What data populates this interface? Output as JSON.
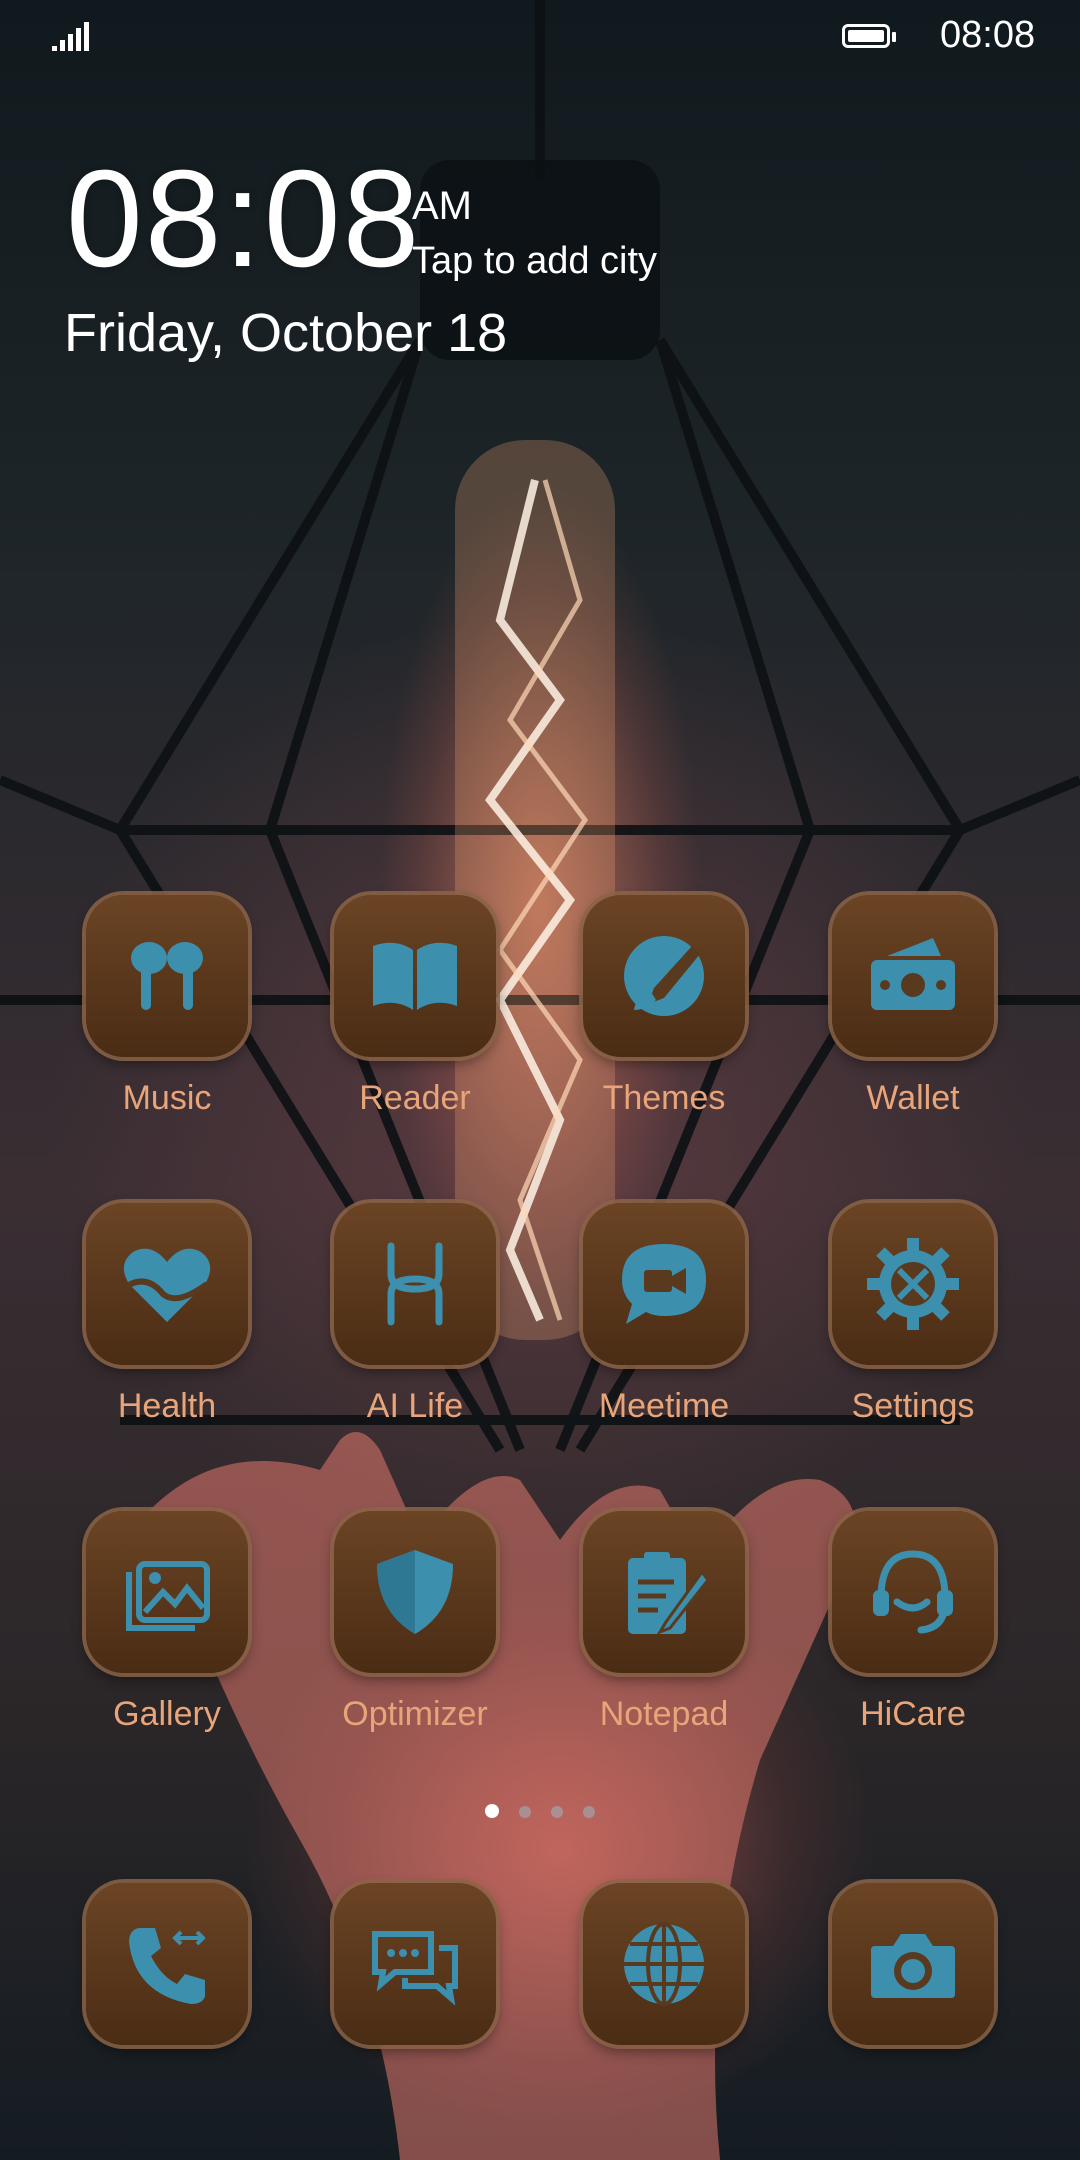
{
  "status_bar": {
    "time": "08:08",
    "signal_icon": "signal-icon",
    "battery_icon": "battery-icon"
  },
  "clock_widget": {
    "time": "08:08",
    "ampm": "AM",
    "city_prompt": "Tap to add city",
    "date": "Friday, October 18"
  },
  "apps": [
    {
      "label": "Music",
      "icon": "earbuds-icon"
    },
    {
      "label": "Reader",
      "icon": "book-icon"
    },
    {
      "label": "Themes",
      "icon": "paintbrush-icon"
    },
    {
      "label": "Wallet",
      "icon": "wallet-icon"
    },
    {
      "label": "Health",
      "icon": "heart-icon"
    },
    {
      "label": "AI Life",
      "icon": "ai-life-icon"
    },
    {
      "label": "Meetime",
      "icon": "video-chat-icon"
    },
    {
      "label": "Settings",
      "icon": "gear-icon"
    },
    {
      "label": "Gallery",
      "icon": "gallery-icon"
    },
    {
      "label": "Optimizer",
      "icon": "shield-icon"
    },
    {
      "label": "Notepad",
      "icon": "notepad-icon"
    },
    {
      "label": "HiCare",
      "icon": "headset-icon"
    }
  ],
  "dock": [
    {
      "icon": "phone-icon"
    },
    {
      "icon": "messages-icon"
    },
    {
      "icon": "browser-globe-icon"
    },
    {
      "icon": "camera-icon"
    }
  ],
  "page_indicator": {
    "pages": 4,
    "active": 1
  },
  "colors": {
    "icon_glyph": "#3d8fae",
    "tile_top": "#6b4424",
    "tile_bottom": "#4a2c14",
    "label": "#e8a57a"
  }
}
